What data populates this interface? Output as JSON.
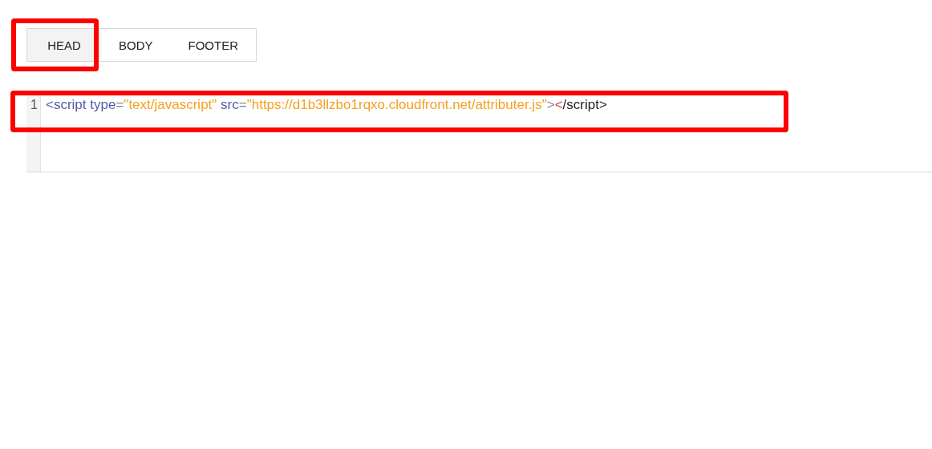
{
  "tabs": [
    {
      "label": "HEAD",
      "selected": true,
      "highlighted": true
    },
    {
      "label": "BODY",
      "selected": false,
      "highlighted": false
    },
    {
      "label": "FOOTER",
      "selected": false,
      "highlighted": false
    }
  ],
  "editor": {
    "lines": [
      {
        "number": "1",
        "highlighted": true,
        "tokens": [
          {
            "kind": "tag",
            "text": "<script"
          },
          {
            "kind": "attr",
            "text": " type"
          },
          {
            "kind": "punct",
            "text": "="
          },
          {
            "kind": "string",
            "text": "\"text/javascript\""
          },
          {
            "kind": "attr",
            "text": " src"
          },
          {
            "kind": "punct",
            "text": "="
          },
          {
            "kind": "string",
            "text": "\"https://d1b3llzbo1rqxo.cloudfront.net/attributer.js\""
          },
          {
            "kind": "punct",
            "text": ">"
          },
          {
            "kind": "bracket",
            "text": "<"
          },
          {
            "kind": "plain",
            "text": "/script>"
          }
        ]
      }
    ]
  }
}
